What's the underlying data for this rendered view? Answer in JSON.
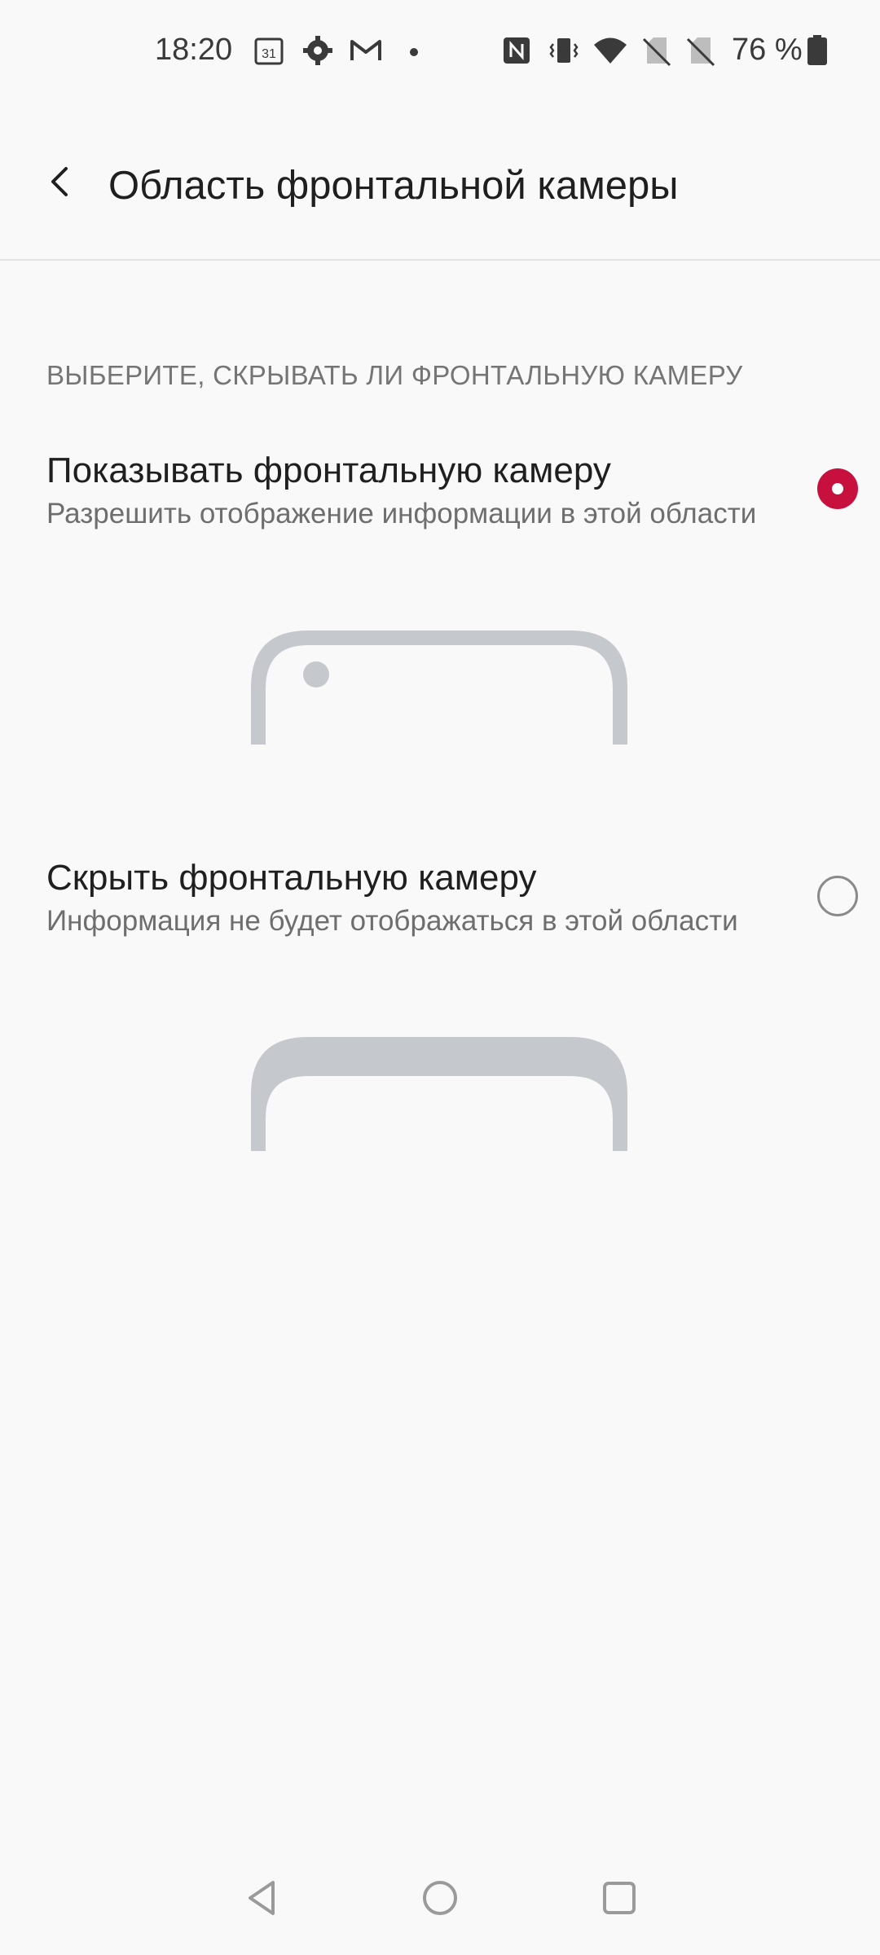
{
  "status_bar": {
    "time": "18:20",
    "battery_percent": "76 %",
    "icons": [
      "calendar-icon",
      "settings-icon",
      "gmail-icon",
      "dot-icon",
      "nfc-icon",
      "vibrate-icon",
      "wifi-icon",
      "no-sim-icon",
      "no-sim-icon",
      "battery-icon"
    ]
  },
  "app_bar": {
    "title": "Область фронтальной камеры",
    "back_icon": "back-arrow-icon"
  },
  "section": {
    "header": "ВЫБЕРИТЕ, СКРЫВАТЬ ЛИ ФРОНТАЛЬНУЮ КАМЕРУ"
  },
  "options": [
    {
      "title": "Показывать фронтальную камеру",
      "subtitle": "Разрешить отображение информации в этой области",
      "selected": true
    },
    {
      "title": "Скрыть фронтальную камеру",
      "subtitle": "Информация не будет отображаться в этой области",
      "selected": false
    }
  ],
  "colors": {
    "accent": "#c8103f",
    "illustration": "#c5c8cc",
    "background": "#f9f9f9"
  },
  "nav_bar": {
    "icons": [
      "back-triangle-icon",
      "home-circle-icon",
      "recents-square-icon"
    ]
  }
}
